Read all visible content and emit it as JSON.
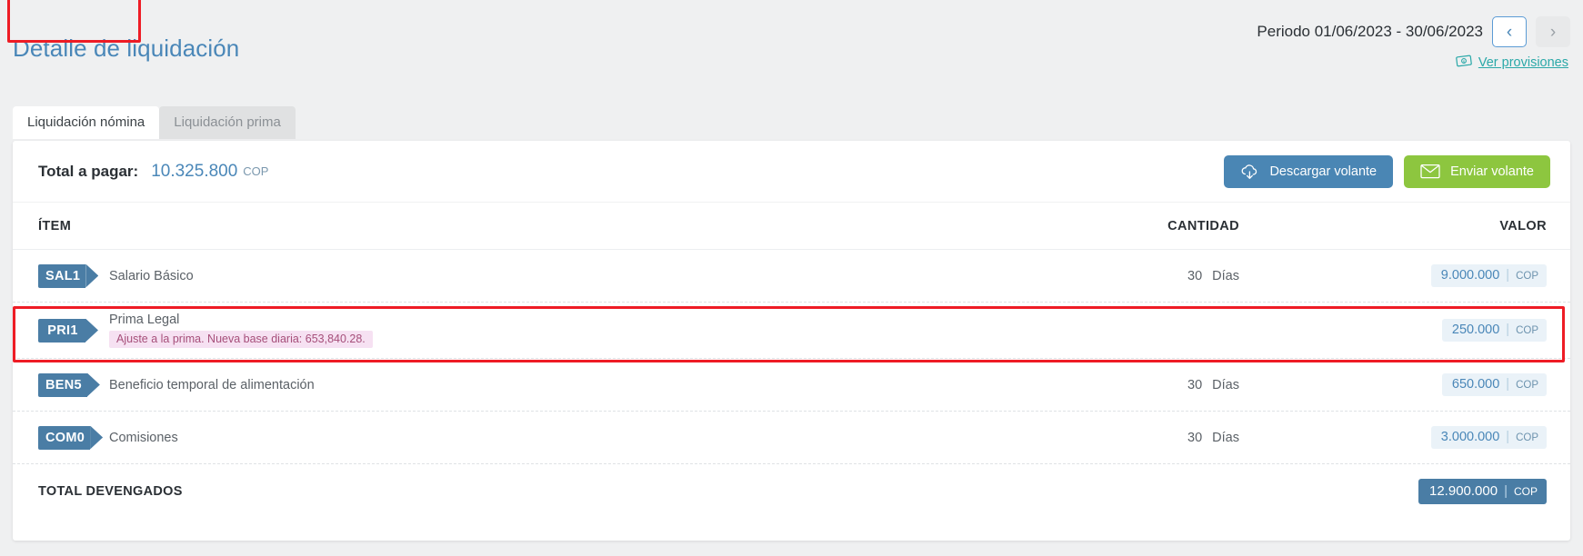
{
  "header": {
    "title": "Detalle de liquidación",
    "period_label": "Periodo 01/06/2023 - 30/06/2023",
    "prev_glyph": "‹",
    "next_glyph": "›",
    "provisiones_label": "Ver provisiones",
    "provisiones_icon": "banknote-icon"
  },
  "tabs": [
    {
      "label": "Liquidación nómina",
      "active": true
    },
    {
      "label": "Liquidación prima",
      "active": false
    }
  ],
  "totalbar": {
    "label": "Total a pagar:",
    "value": "10.325.800",
    "currency": "COP",
    "download_button": {
      "label": "Descargar volante",
      "icon": "cloud-download-icon",
      "color": "#4a86b4"
    },
    "send_button": {
      "label": "Enviar volante",
      "icon": "envelope-icon",
      "color": "#8dc63f"
    }
  },
  "table": {
    "columns": [
      "ÍTEM",
      "CANTIDAD",
      "VALOR"
    ],
    "rows": [
      {
        "code": "SAL1",
        "name": "Salario Básico",
        "note": "",
        "qty": "30",
        "qty_unit": "Días",
        "value": "9.000.000",
        "currency": "COP",
        "highlighted": false
      },
      {
        "code": "PRI1",
        "name": "Prima Legal",
        "note": "Ajuste a la prima. Nueva base diaria: 653,840.28.",
        "qty": "",
        "qty_unit": "",
        "value": "250.000",
        "currency": "COP",
        "highlighted": true
      },
      {
        "code": "BEN5",
        "name": "Beneficio temporal de alimentación",
        "note": "",
        "qty": "30",
        "qty_unit": "Días",
        "value": "650.000",
        "currency": "COP",
        "highlighted": false
      },
      {
        "code": "COM0",
        "name": "Comisiones",
        "note": "",
        "qty": "30",
        "qty_unit": "Días",
        "value": "3.000.000",
        "currency": "COP",
        "highlighted": false
      }
    ],
    "total_row": {
      "label": "TOTAL DEVENGADOS",
      "value": "12.900.000",
      "currency": "COP"
    }
  },
  "colors": {
    "accent_blue": "#4a87b8",
    "badge_blue": "#4a7da5",
    "green": "#8dc63f",
    "highlight_red": "#ee1c25",
    "note_pink": "#f6e1f2",
    "link_teal": "#2aa8a8"
  }
}
